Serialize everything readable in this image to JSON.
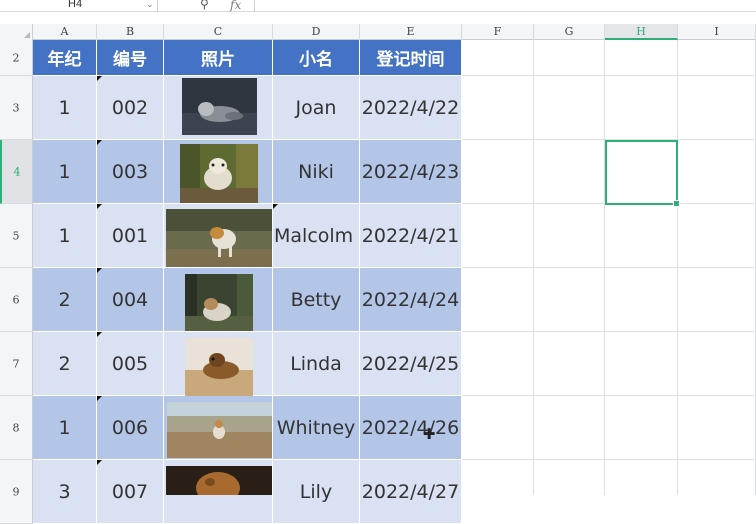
{
  "formula_bar": {
    "cell_ref": "H4",
    "fx_label": "fx",
    "formula": ""
  },
  "columns": [
    "A",
    "B",
    "C",
    "D",
    "E",
    "F",
    "G",
    "H",
    "I"
  ],
  "selected_column": "H",
  "rows": [
    "2",
    "3",
    "4",
    "5",
    "6",
    "7",
    "8",
    "9"
  ],
  "selected_row": "4",
  "table": {
    "headers": [
      "年纪",
      "编号",
      "照片",
      "小名",
      "登记时间"
    ],
    "records": [
      {
        "grade": "1",
        "id": "002",
        "photo": "dog-photo-joan",
        "name": "Joan",
        "date": "2022/4/22"
      },
      {
        "grade": "1",
        "id": "003",
        "photo": "dog-photo-niki",
        "name": "Niki",
        "date": "2022/4/23"
      },
      {
        "grade": "1",
        "id": "001",
        "photo": "dog-photo-malcolm",
        "name": "Malcolm",
        "date": "2022/4/21"
      },
      {
        "grade": "2",
        "id": "004",
        "photo": "dog-photo-betty",
        "name": "Betty",
        "date": "2022/4/24"
      },
      {
        "grade": "2",
        "id": "005",
        "photo": "dog-photo-linda",
        "name": "Linda",
        "date": "2022/4/25"
      },
      {
        "grade": "1",
        "id": "006",
        "photo": "dog-photo-whitney",
        "name": "Whitney",
        "date": "2022/4/26"
      },
      {
        "grade": "3",
        "id": "007",
        "photo": "dog-photo-lily",
        "name": "Lily",
        "date": "2022/4/27"
      }
    ]
  },
  "colors": {
    "header_blue": "#4472c4",
    "row_light": "#d9e1f2",
    "row_dark": "#b4c6e7",
    "selection_green": "#2fae77"
  },
  "icons": {
    "zoom": "magnifier-icon",
    "dropdown": "chevron-down-icon",
    "cursor": "cell-select-cursor-icon"
  }
}
